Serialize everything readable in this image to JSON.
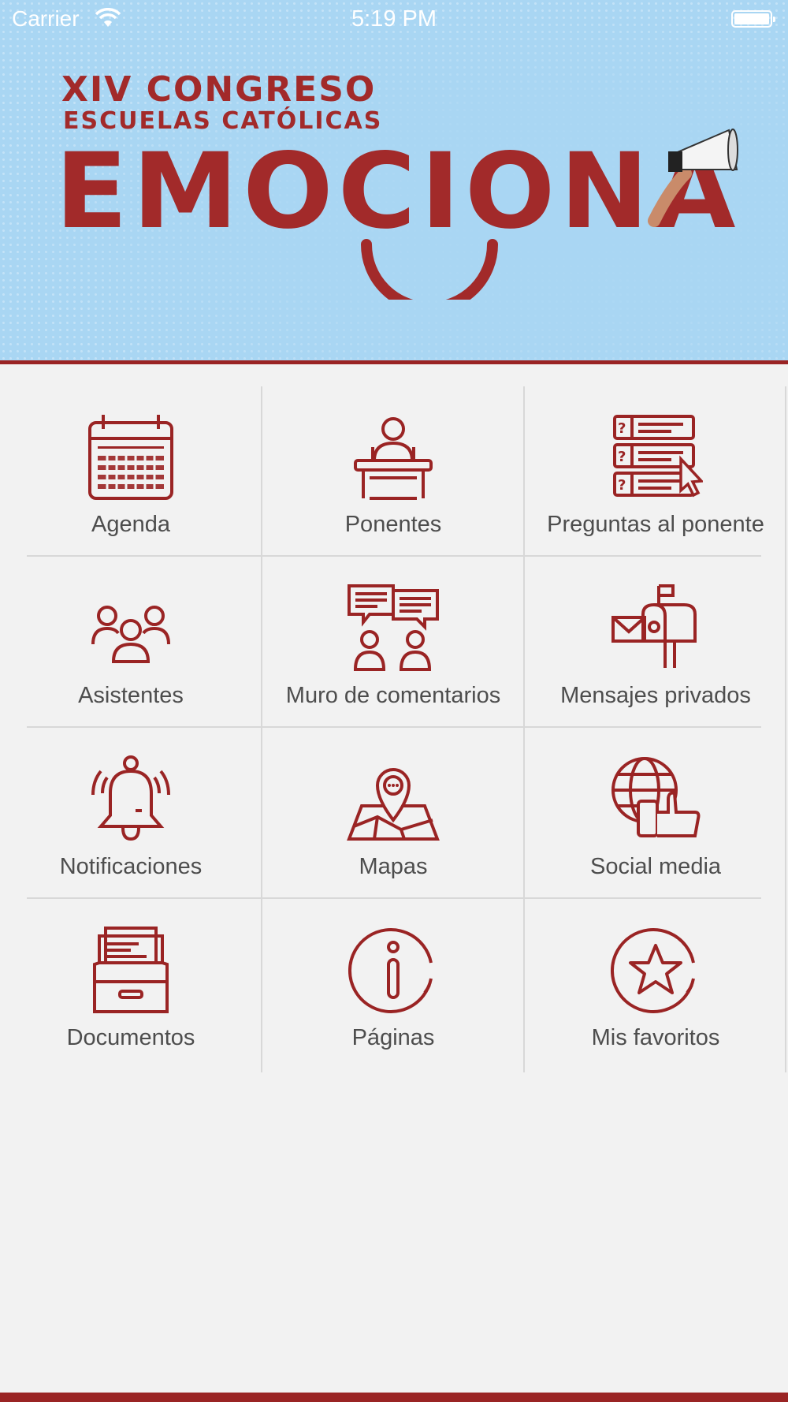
{
  "status_bar": {
    "carrier": "Carrier",
    "time": "5:19 PM"
  },
  "banner": {
    "line1": "XIV CONGRESO",
    "line2": "ESCUELAS CATÓLICAS",
    "main": "EMOCIONA"
  },
  "colors": {
    "brand_red": "#9a2424",
    "banner_blue": "#a9d6f3",
    "label_gray": "#4d4d4d"
  },
  "menu": [
    {
      "label": "Agenda",
      "icon": "calendar-icon"
    },
    {
      "label": "Ponentes",
      "icon": "speaker-podium-icon"
    },
    {
      "label": "Preguntas al ponente",
      "icon": "questions-list-icon"
    },
    {
      "label": "Asistentes",
      "icon": "attendees-icon"
    },
    {
      "label": "Muro de comentarios",
      "icon": "comments-wall-icon"
    },
    {
      "label": "Mensajes privados",
      "icon": "mailbox-icon"
    },
    {
      "label": "Notificaciones",
      "icon": "bell-icon"
    },
    {
      "label": "Mapas",
      "icon": "map-pin-icon"
    },
    {
      "label": "Social media",
      "icon": "social-globe-like-icon"
    },
    {
      "label": "Documentos",
      "icon": "file-drawer-icon"
    },
    {
      "label": "Páginas",
      "icon": "info-icon"
    },
    {
      "label": "Mis favoritos",
      "icon": "star-icon"
    }
  ]
}
